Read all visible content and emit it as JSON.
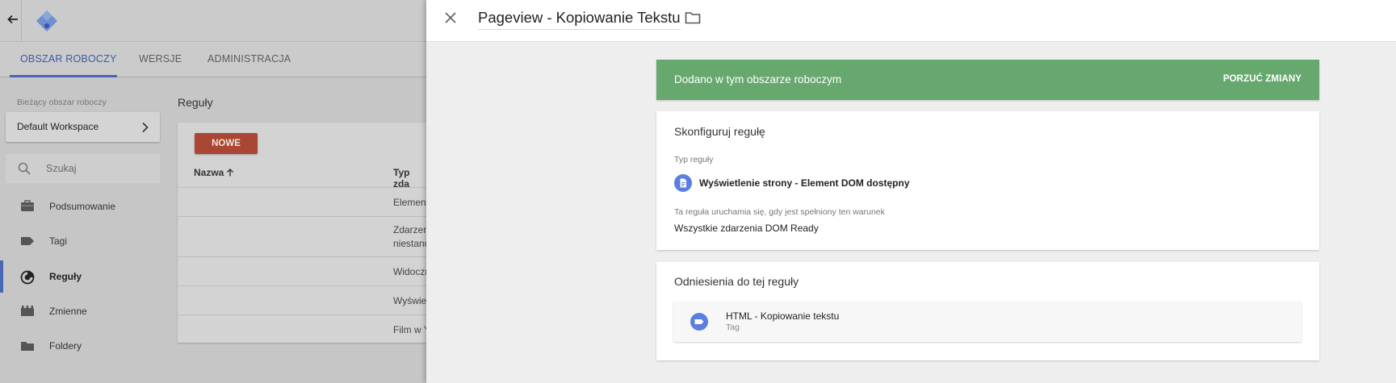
{
  "background_app": {
    "nav": {
      "tabs": [
        {
          "label": "OBSZAR ROBOCZY"
        },
        {
          "label": "WERSJE"
        },
        {
          "label": "ADMINISTRACJA"
        }
      ]
    },
    "workspace": {
      "label": "Bieżący obszar roboczy",
      "name": "Default Workspace"
    },
    "search": {
      "placeholder": "Szukaj"
    },
    "sidebar": {
      "items": [
        {
          "label": "Podsumowanie",
          "icon": "briefcase-icon"
        },
        {
          "label": "Tagi",
          "icon": "tag-icon"
        },
        {
          "label": "Reguły",
          "icon": "trigger-icon"
        },
        {
          "label": "Zmienne",
          "icon": "variables-icon"
        },
        {
          "label": "Foldery",
          "icon": "folder-icon"
        }
      ]
    },
    "triggers_list": {
      "title": "Reguły",
      "new_button": "NOWE",
      "columns": [
        "Nazwa",
        "Typ zda"
      ],
      "rows": [
        {
          "type_line1": "Element",
          "type_line2": ""
        },
        {
          "type_line1": "Zdarzen",
          "type_line2": "niestand"
        },
        {
          "type_line1": "Widoczn",
          "type_line2": ""
        },
        {
          "type_line1": "Wyświe",
          "type_line2": ""
        },
        {
          "type_line1": "Film w Y",
          "type_line2": ""
        }
      ]
    }
  },
  "panel": {
    "title": "Pageview - Kopiowanie Tekstu",
    "status_text": "Dodano w tym obszarze roboczym",
    "discard_button": "PORZUĆ ZMIANY",
    "config_card": {
      "title": "Skonfiguruj regułę",
      "type_label": "Typ reguły",
      "trigger_type": "Wyświetlenie strony - Element DOM dostępny",
      "condition_label": "Ta reguła uruchamia się, gdy jest spełniony ten warunek",
      "condition_value": "Wszystkie zdarzenia DOM Ready"
    },
    "references_card": {
      "title": "Odniesienia do tej reguły",
      "items": [
        {
          "name": "HTML - Kopiowanie tekstu",
          "type": "Tag"
        }
      ]
    }
  },
  "colors": {
    "status_green": "#67a86e",
    "accent_blue": "#4a66b5",
    "new_button_red": "#a94734",
    "icon_blue": "#5b7fe0"
  }
}
